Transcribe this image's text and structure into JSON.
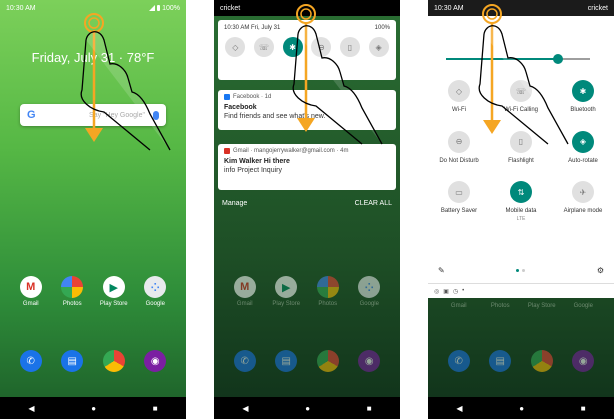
{
  "panels": {
    "home": {
      "status_time": "10:30 AM",
      "status_battery": "100%",
      "date_weather": "Friday, July 31 · 78°F",
      "search_placeholder": "Say \"Hey Google\"",
      "apps": [
        {
          "label": "Gmail",
          "icon": "gmail-icon",
          "color": "#ffffff"
        },
        {
          "label": "Photos",
          "icon": "photos-icon",
          "color": "#ffffff"
        },
        {
          "label": "Play Store",
          "icon": "play-store-icon",
          "color": "#ffffff"
        },
        {
          "label": "Google",
          "icon": "google-icon",
          "color": "#ffffff"
        }
      ],
      "dock": [
        "phone-icon",
        "messages-icon",
        "chrome-icon",
        "camera-icon"
      ]
    },
    "shade": {
      "carrier": "cricket",
      "header_left": "10:30 AM Fri, July 31",
      "header_right": "100%",
      "tiles": [
        "wifi-icon",
        "wifi-calling-icon",
        "bluetooth-icon",
        "dnd-icon",
        "flashlight-icon",
        "auto-rotate-icon"
      ],
      "notifications": [
        {
          "source": "Facebook · 1d",
          "title": "Facebook",
          "body": "Find friends and see what's new."
        },
        {
          "source": "Gmail · mangojerrywalker@gmail.com · 4m",
          "title": "Kim Walker Hi there",
          "body": "info Project Inquiry"
        }
      ],
      "manage_label": "Manage",
      "clear_label": "CLEAR ALL",
      "apps": [
        "Gmail",
        "Play Store",
        "Photos",
        "Google"
      ]
    },
    "quick": {
      "status_time": "10:30 AM",
      "carrier": "cricket",
      "tiles": [
        {
          "label": "Wi-Fi",
          "sub": "",
          "icon": "wifi-icon",
          "on": false
        },
        {
          "label": "Wi-Fi Calling",
          "sub": "",
          "icon": "wifi-calling-icon",
          "on": false
        },
        {
          "label": "Bluetooth",
          "sub": "",
          "icon": "bluetooth-icon",
          "on": true
        },
        {
          "label": "Do Not Disturb",
          "sub": "",
          "icon": "dnd-icon",
          "on": false
        },
        {
          "label": "Flashlight",
          "sub": "",
          "icon": "flashlight-icon",
          "on": false
        },
        {
          "label": "Auto-rotate",
          "sub": "",
          "icon": "auto-rotate-icon",
          "on": true
        },
        {
          "label": "Battery Saver",
          "sub": "",
          "icon": "battery-saver-icon",
          "on": false
        },
        {
          "label": "Mobile data",
          "sub": "LTE",
          "icon": "mobile-data-icon",
          "on": true
        },
        {
          "label": "Airplane mode",
          "sub": "",
          "icon": "airplane-icon",
          "on": false
        }
      ],
      "brightness": 0.78,
      "apps": [
        "Gmail",
        "Photos",
        "Play Store",
        "Google"
      ]
    }
  },
  "colors": {
    "accent": "#00897b",
    "arrow": "#f5a623"
  }
}
